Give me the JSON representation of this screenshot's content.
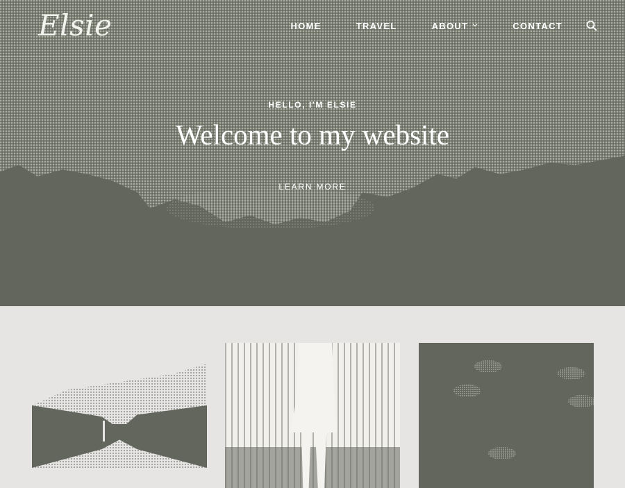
{
  "site": {
    "logo": "Elsie"
  },
  "nav": {
    "items": [
      {
        "label": "HOME"
      },
      {
        "label": "TRAVEL"
      },
      {
        "label": "ABOUT",
        "has_dropdown": true
      },
      {
        "label": "CONTACT"
      }
    ],
    "search_icon": "search-icon"
  },
  "hero": {
    "eyebrow": "HELLO, I'M ELSIE",
    "headline": "Welcome to my website",
    "cta_label": "LEARN MORE"
  },
  "colors": {
    "hero_bg": "#62665c",
    "page_bg": "#e7e4e4",
    "text": "#ffffff"
  }
}
